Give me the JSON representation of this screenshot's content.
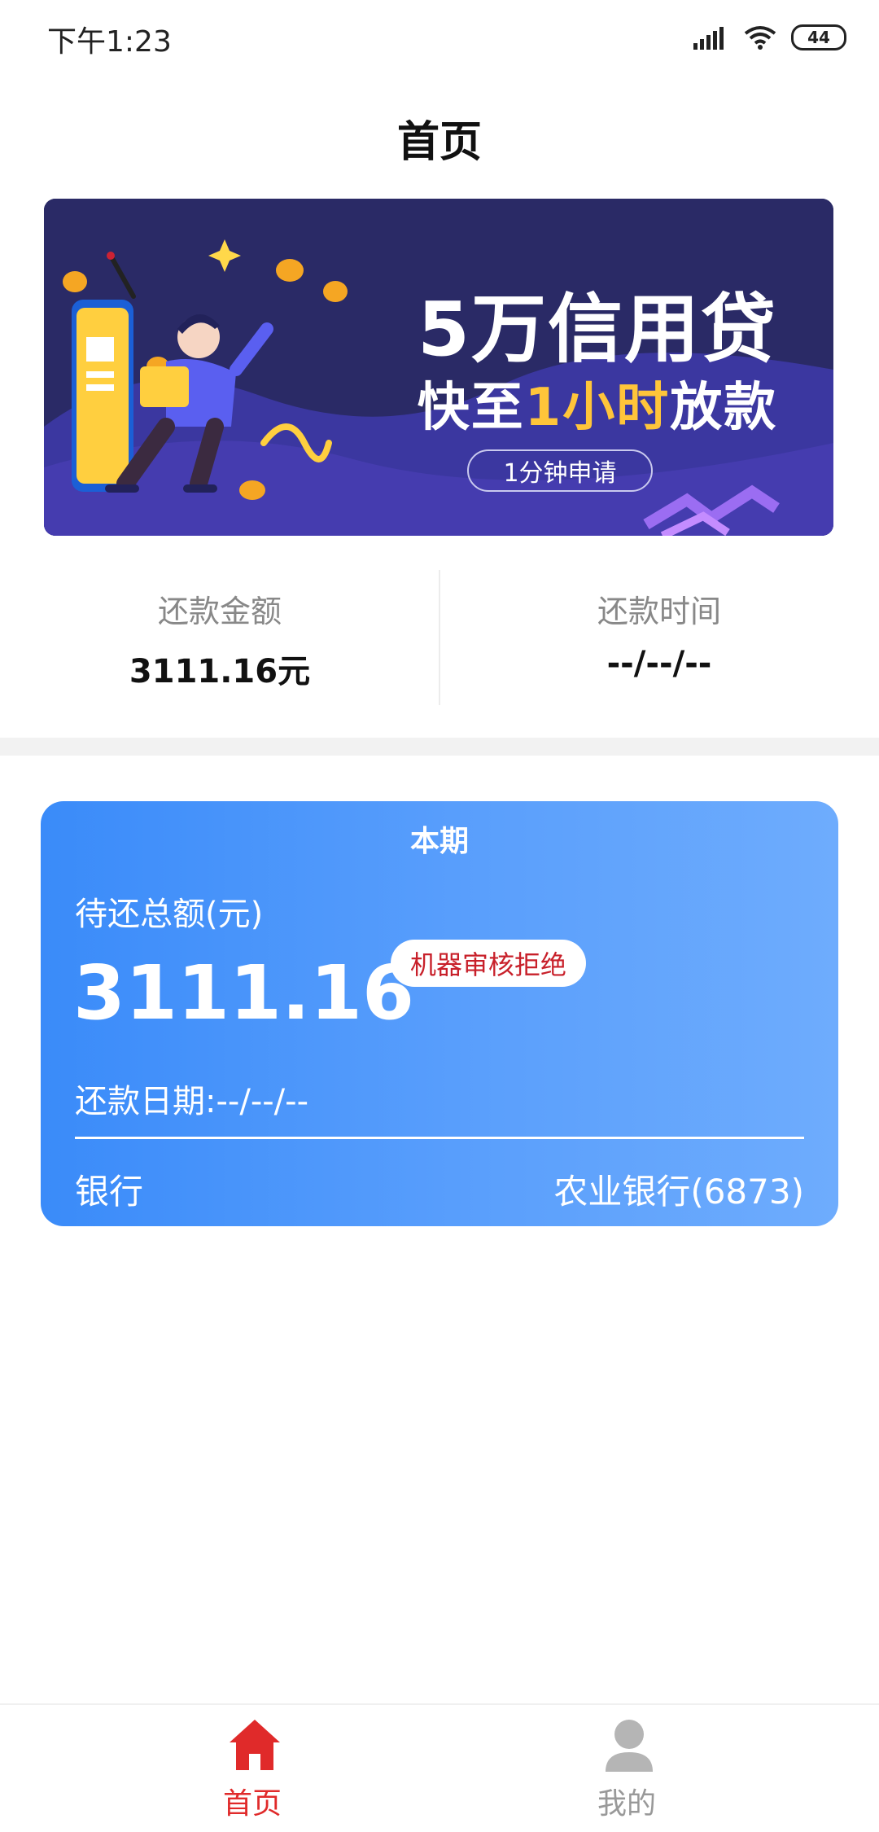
{
  "status_bar": {
    "time": "下午1:23",
    "battery": "44"
  },
  "page_title": "首页",
  "banner": {
    "line1": "5万信用贷",
    "line2_prefix": "快至",
    "line2_highlight": "1小时",
    "line2_suffix": "放款",
    "button": "1分钟申请",
    "colors": {
      "background": "#2a2a66",
      "highlight": "#ffc53a"
    }
  },
  "summary": {
    "repay_amount_label": "还款金额",
    "repay_amount_value": "3111.16元",
    "repay_time_label": "还款时间",
    "repay_time_value": "--/--/--"
  },
  "card": {
    "title": "本期",
    "total_label": "待还总额(元)",
    "total_value": "3111.16",
    "status_badge": "机器审核拒绝",
    "repay_date": "还款日期:--/--/--",
    "bank_label": "银行",
    "bank_value": "农业银行(6873)",
    "colors": {
      "gradient_start": "#3a8bf9",
      "gradient_end": "#6eacfd",
      "badge_text": "#c8202a"
    }
  },
  "tabbar": {
    "tabs": [
      {
        "label": "首页",
        "icon": "home-icon",
        "active": true
      },
      {
        "label": "我的",
        "icon": "user-icon",
        "active": false
      }
    ],
    "colors": {
      "active": "#e02a2a",
      "inactive": "#999999"
    }
  }
}
